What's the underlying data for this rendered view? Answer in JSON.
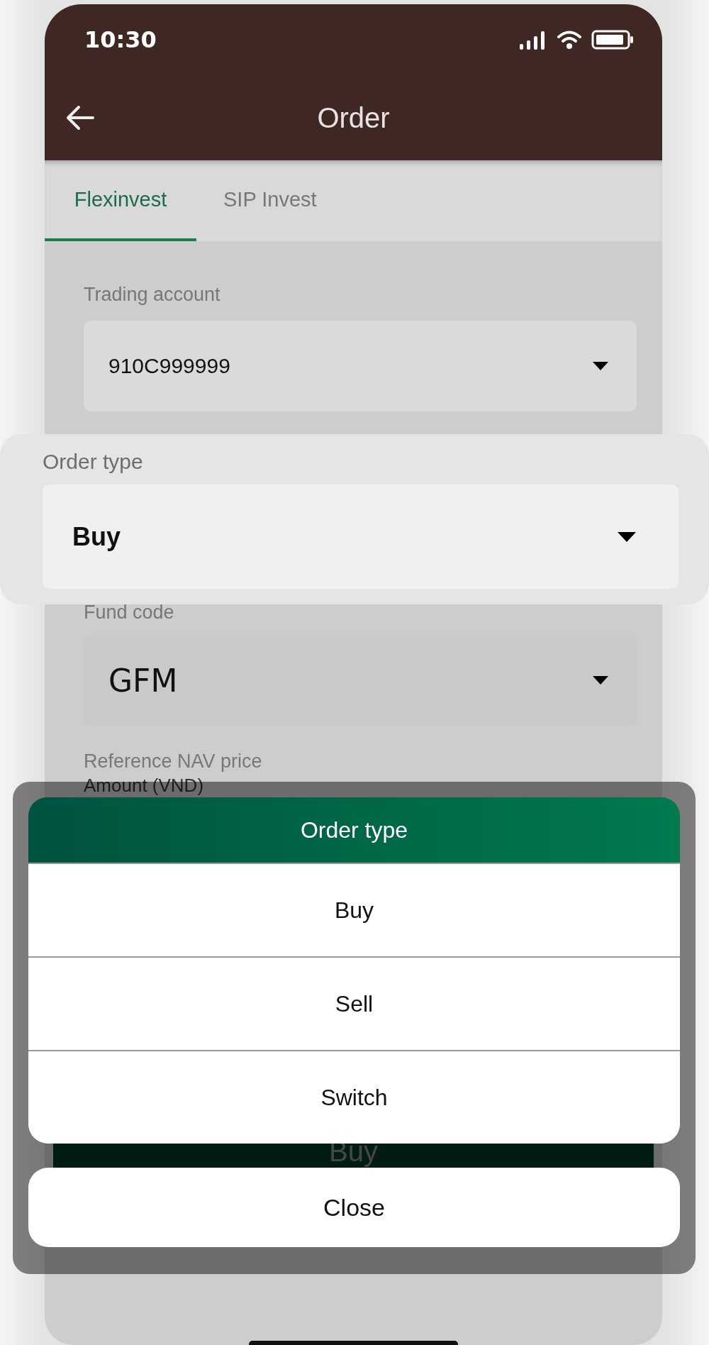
{
  "status_bar": {
    "time": "10:30"
  },
  "header": {
    "title": "Order"
  },
  "tabs": [
    {
      "label": "Flexinvest",
      "selected": true
    },
    {
      "label": "SIP Invest",
      "selected": false
    }
  ],
  "form": {
    "trading_account": {
      "label": "Trading account",
      "value": "910C999999"
    },
    "order_type": {
      "label": "Order type",
      "value": "Buy"
    },
    "fund_code": {
      "label": "Fund code",
      "value": "GFM"
    },
    "reference_nav_price": {
      "label": "Reference NAV price"
    },
    "amount": {
      "label": "Amount (VND)"
    }
  },
  "submit_button": {
    "label": "Buy"
  },
  "order_type_sheet": {
    "title": "Order type",
    "options": [
      {
        "label": "Buy"
      },
      {
        "label": "Sell"
      },
      {
        "label": "Switch"
      }
    ],
    "close_button": "Close"
  }
}
